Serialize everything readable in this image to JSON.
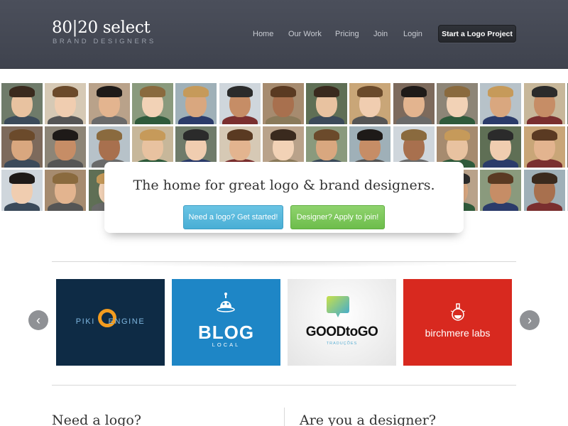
{
  "brand": {
    "name": "80|20 select",
    "tagline": "BRAND DESIGNERS"
  },
  "nav": {
    "items": [
      "Home",
      "Our Work",
      "Pricing",
      "Join",
      "Login"
    ],
    "cta": "Start a Logo Project"
  },
  "hero": {
    "title": "The home for great logo & brand designers.",
    "primary_button": "Need a logo? Get started!",
    "secondary_button": "Designer? Apply to join!"
  },
  "portfolio": {
    "prev_label": "‹",
    "next_label": "›",
    "tiles": [
      {
        "logo_text_a": "PIKI",
        "logo_text_b": "ENGINE",
        "background": "#0e2b45"
      },
      {
        "logo_text_a": "BLOG",
        "logo_text_b": "LOCAL",
        "background": "#1e86c6"
      },
      {
        "logo_text_a": "GOODtoGO",
        "logo_text_b": "TRADUÇÕES",
        "background": "#f2f2f2"
      },
      {
        "logo_text_a": "birchmere labs",
        "background": "#d8291f"
      }
    ]
  },
  "sections": {
    "left_heading": "Need a logo?",
    "right_heading": "Are you a designer?"
  },
  "colors": {
    "header": "#444853",
    "blue_button": "#55b6dc",
    "green_button": "#7ac75a"
  }
}
